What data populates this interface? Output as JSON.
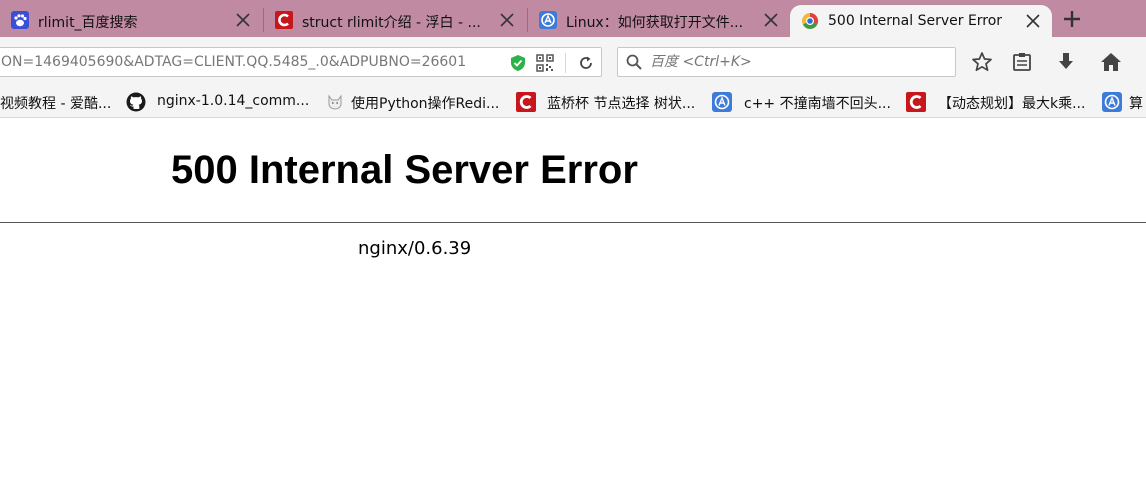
{
  "tabs": [
    {
      "title": "rlimit_百度搜索",
      "icon": "baidu-paw-icon"
    },
    {
      "title": "struct rlimit介绍 - 浮白 - ...",
      "icon": "csdn-icon"
    },
    {
      "title": "Linux：如何获取打开文件...",
      "icon": "blog-icon"
    },
    {
      "title": "500 Internal Server Error",
      "icon": "browser-logo-icon",
      "active": true
    }
  ],
  "navbar": {
    "url": "ON=1469405690&ADTAG=CLIENT.QQ.5485_.0&ADPUBNO=26601",
    "search_placeholder": "百度 <Ctrl+K>"
  },
  "bookmarks": [
    {
      "label": "视频教程 - 爱酷...",
      "icon": "none"
    },
    {
      "label": "nginx-1.0.14_comm...",
      "icon": "github-icon"
    },
    {
      "label": "使用Python操作Redi...",
      "icon": "cat-icon"
    },
    {
      "label": "蓝桥杯 节点选择 树状...",
      "icon": "csdn-icon"
    },
    {
      "label": "c++ 不撞南墙不回头...",
      "icon": "blog-icon"
    },
    {
      "label": "【动态规划】最大k乘...",
      "icon": "csdn-icon"
    },
    {
      "label": "算",
      "icon": "blog-icon"
    }
  ],
  "page": {
    "title": "500 Internal Server Error",
    "server": "nginx/0.6.39"
  },
  "colors": {
    "tabstrip": "#c08aa2",
    "toolbar": "#f4f4f4",
    "csdn_red": "#c8161d",
    "blog_blue": "#3d7bd8"
  }
}
